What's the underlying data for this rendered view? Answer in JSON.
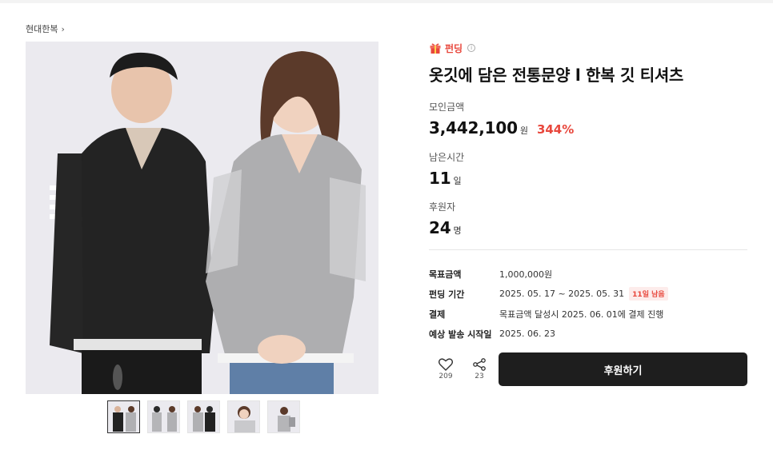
{
  "breadcrumb": {
    "store": "현대한복",
    "chevron": "›"
  },
  "product": {
    "tag": "펀딩",
    "title": "옷깃에 담은 전통문양 l 한복 깃 티셔츠"
  },
  "stats": {
    "raised_label": "모인금액",
    "raised_value": "3,442,100",
    "raised_unit": "원",
    "raised_percent": "344%",
    "remaining_label": "남은시간",
    "remaining_value": "11",
    "remaining_unit": "일",
    "supporters_label": "후원자",
    "supporters_value": "24",
    "supporters_unit": "명"
  },
  "details": [
    {
      "key": "목표금액",
      "value": "1,000,000원"
    },
    {
      "key": "펀딩 기간",
      "value": "2025. 05. 17 ~ 2025. 05. 31",
      "badge": "11일 남음"
    },
    {
      "key": "결제",
      "value": "목표금액 달성시 2025. 06. 01에 결제 진행"
    },
    {
      "key": "예상 발송 시작일",
      "value": "2025. 06. 23"
    }
  ],
  "actions": {
    "like_count": "209",
    "share_count": "23",
    "support_label": "후원하기"
  },
  "colors": {
    "accent": "#e8473c",
    "cta_bg": "#1e1e1e"
  },
  "icons": {
    "tag": "gift-icon",
    "info": "info-icon",
    "like": "heart-icon",
    "share": "share-icon"
  },
  "thumbnails": 5
}
